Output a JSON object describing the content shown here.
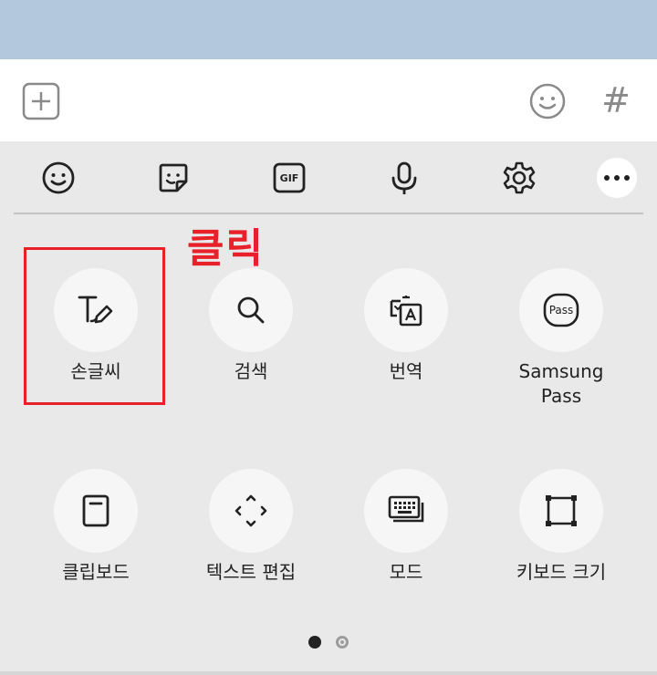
{
  "annotation": {
    "text": "클릭",
    "color": "#e8202a"
  },
  "input_bar": {
    "add_icon": "plus-square-icon",
    "emoji_icon": "smiley-icon",
    "hash_label": "#"
  },
  "toolbar": {
    "items": [
      {
        "icon": "emoji-icon"
      },
      {
        "icon": "sticker-icon"
      },
      {
        "icon": "gif-icon",
        "text": "GIF"
      },
      {
        "icon": "microphone-icon"
      },
      {
        "icon": "gear-icon"
      },
      {
        "icon": "more-icon"
      }
    ]
  },
  "grid": {
    "items": [
      {
        "label": "손글씨",
        "icon": "handwriting-icon"
      },
      {
        "label": "검색",
        "icon": "search-icon"
      },
      {
        "label": "번역",
        "icon": "translate-icon"
      },
      {
        "label": "Samsung Pass",
        "icon": "samsung-pass-icon",
        "icon_text": "Pass"
      },
      {
        "label": "클립보드",
        "icon": "clipboard-icon"
      },
      {
        "label": "텍스트 편집",
        "icon": "text-edit-icon"
      },
      {
        "label": "모드",
        "icon": "keyboard-mode-icon"
      },
      {
        "label": "키보드 크기",
        "icon": "keyboard-size-icon"
      }
    ]
  },
  "pager": {
    "current": 1,
    "total": 2
  },
  "colors": {
    "accent_red": "#e8202a",
    "top_bar": "#b3c8dc",
    "panel": "#e9e9e9"
  }
}
